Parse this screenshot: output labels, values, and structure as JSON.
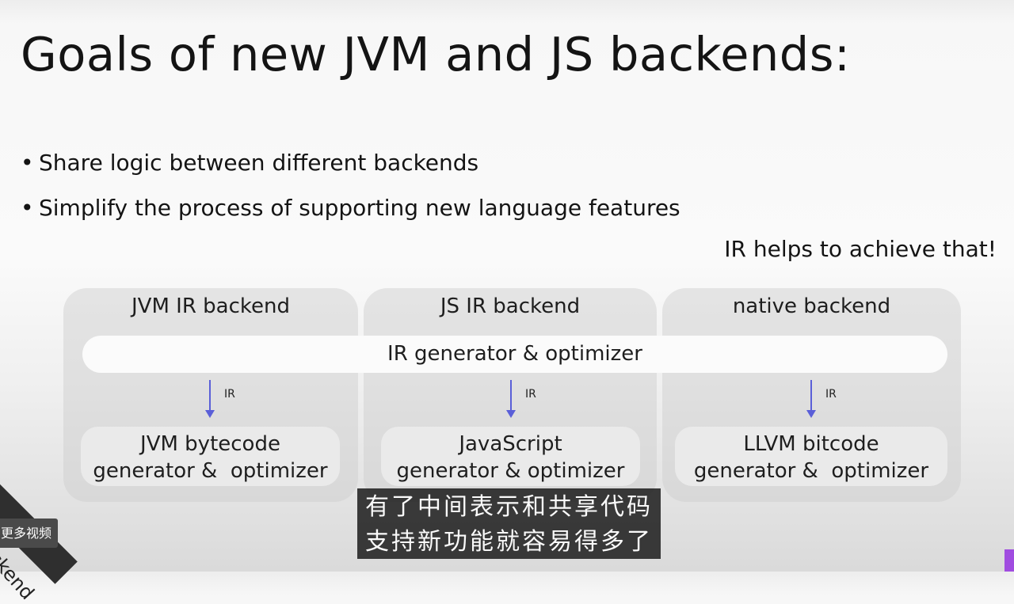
{
  "slide": {
    "title": "Goals of new JVM and JS backends:",
    "bullets": [
      "Share logic between different backends",
      "Simplify the process of supporting new language features"
    ],
    "bullet_glyph": "•",
    "note": "IR helps to achieve that!"
  },
  "diagram": {
    "shared_stage": "IR generator & optimizer",
    "edge_label": "IR",
    "panels": [
      {
        "title": "JVM IR backend",
        "generator_line1": "JVM bytecode",
        "generator_line2": "generator &  optimizer"
      },
      {
        "title": "JS IR backend",
        "generator_line1": "JavaScript",
        "generator_line2": "generator & optimizer"
      },
      {
        "title": "native backend",
        "generator_line1": "LLVM bitcode",
        "generator_line2": "generator &  optimizer"
      }
    ],
    "colors": {
      "arrow": "#5a5fd8",
      "panel": "#cdcdcd"
    }
  },
  "player": {
    "subtitle_line1": "有了中间表示和共享代码",
    "subtitle_line2": "支持新功能就容易得多了",
    "more_videos": "更多视频",
    "corner_text": "Backend"
  }
}
